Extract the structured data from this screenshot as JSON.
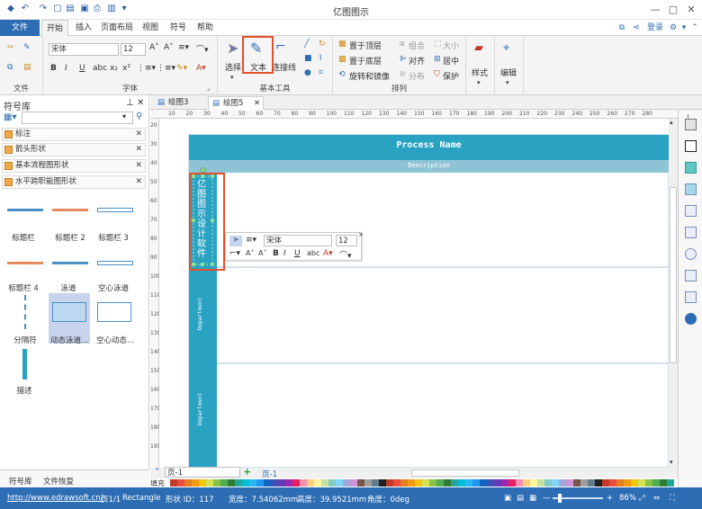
{
  "window": {
    "title": "亿图图示"
  },
  "account": {
    "login": "登录"
  },
  "tabs": [
    "文件",
    "开始",
    "插入",
    "页面布局",
    "视图",
    "符号",
    "帮助"
  ],
  "ribbon": {
    "font_name": "宋体",
    "font_size": "12",
    "groups": {
      "file": "文件",
      "font": "字体",
      "basic_tools": "基本工具",
      "arrange": "排列"
    },
    "tools": {
      "select": "选择",
      "text": "文本",
      "connector": "连接线"
    },
    "arrange": {
      "bring_front": "置于顶层",
      "send_back": "置于底层",
      "rotate_mirror": "旋转和镜像",
      "group": "组合",
      "size": "大小",
      "align": "对齐",
      "center": "居中",
      "distribute": "分布",
      "protect": "保护"
    },
    "style": "样式",
    "edit": "编辑"
  },
  "library": {
    "title": "符号库",
    "items": [
      "标注",
      "箭头形状",
      "基本流程图形状",
      "水平跨职能图形状"
    ],
    "shapes": [
      "标题栏",
      "标题栏 2",
      "标题栏 3",
      "标题栏 4",
      "泳道",
      "空心泳道",
      "分隔符",
      "动态泳道...",
      "空心动态...",
      "描述"
    ],
    "bottom_tabs": [
      "符号库",
      "文件恢复"
    ]
  },
  "documents": [
    "绘图3",
    "绘图5"
  ],
  "ruler": {
    "h": [
      "10",
      "20",
      "30",
      "40",
      "50",
      "60",
      "70",
      "80",
      "90",
      "100",
      "110",
      "120",
      "130",
      "140",
      "150",
      "160",
      "170",
      "180",
      "190",
      "200",
      "210",
      "220",
      "230",
      "240",
      "250",
      "260",
      "270",
      "280"
    ],
    "v": [
      "20",
      "30",
      "40",
      "50",
      "60",
      "70",
      "80",
      "90",
      "100",
      "110",
      "120",
      "130",
      "140",
      "150",
      "160",
      "170",
      "180",
      "190"
    ]
  },
  "diagram": {
    "title": "Process Name",
    "description": "Description",
    "lane_text": "亿图图示设计软件",
    "dept1": "Department",
    "dept2": "Department"
  },
  "floatbar": {
    "font": "宋体",
    "size": "12"
  },
  "pages": {
    "select": "页-1",
    "tab": "页-1"
  },
  "palette_label": "填充",
  "status": {
    "url": "http://www.edrawsoft.cn/",
    "page": "页1/1",
    "shape": "Rectangle",
    "shape_id": "形状 ID：117",
    "width": "宽度：7.54062mm",
    "height": "高度：39.9521mm",
    "angle": "角度：0deg",
    "zoom": "86%"
  },
  "colors": {
    "accent": "#2d6db4",
    "lane": "#2aa3c3",
    "desc": "#8fc4d6",
    "highlight": "#e2502c"
  }
}
